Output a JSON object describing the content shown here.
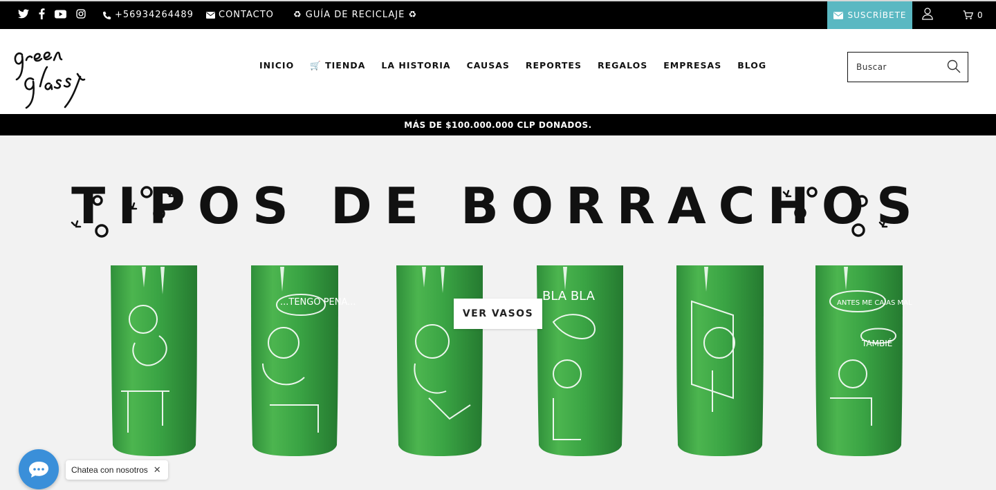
{
  "topbar": {
    "social": [
      "twitter-icon",
      "facebook-icon",
      "youtube-icon",
      "instagram-icon"
    ],
    "phone": "+56934264489",
    "contact": "CONTACTO",
    "guide": "♻ GUÍA DE RECICLAJE ♻",
    "subscribe": "SUSCRÍBETE",
    "cart_count": "0",
    "accent_color": "#5ab8c2"
  },
  "header": {
    "logo_text": "Green Glass",
    "nav": [
      "INICIO",
      "🛒 TIENDA",
      "LA HISTORIA",
      "CAUSAS",
      "REPORTES",
      "REGALOS",
      "EMPRESAS",
      "BLOG"
    ],
    "search_placeholder": "Buscar"
  },
  "banner": "MÁS DE $100.000.000 CLP DONADOS.",
  "hero": {
    "title": "TIPOS DE BORRACHOS",
    "cta": "VER VASOS",
    "glass_texts": [
      "...TENGO PENA...",
      "BLA BLA",
      "ANTES ME CAÍAS MAL",
      "TAMBIÉ"
    ]
  },
  "chat": {
    "label": "Chatea con nosotros",
    "close": "✕",
    "color": "#3a8fd9"
  }
}
